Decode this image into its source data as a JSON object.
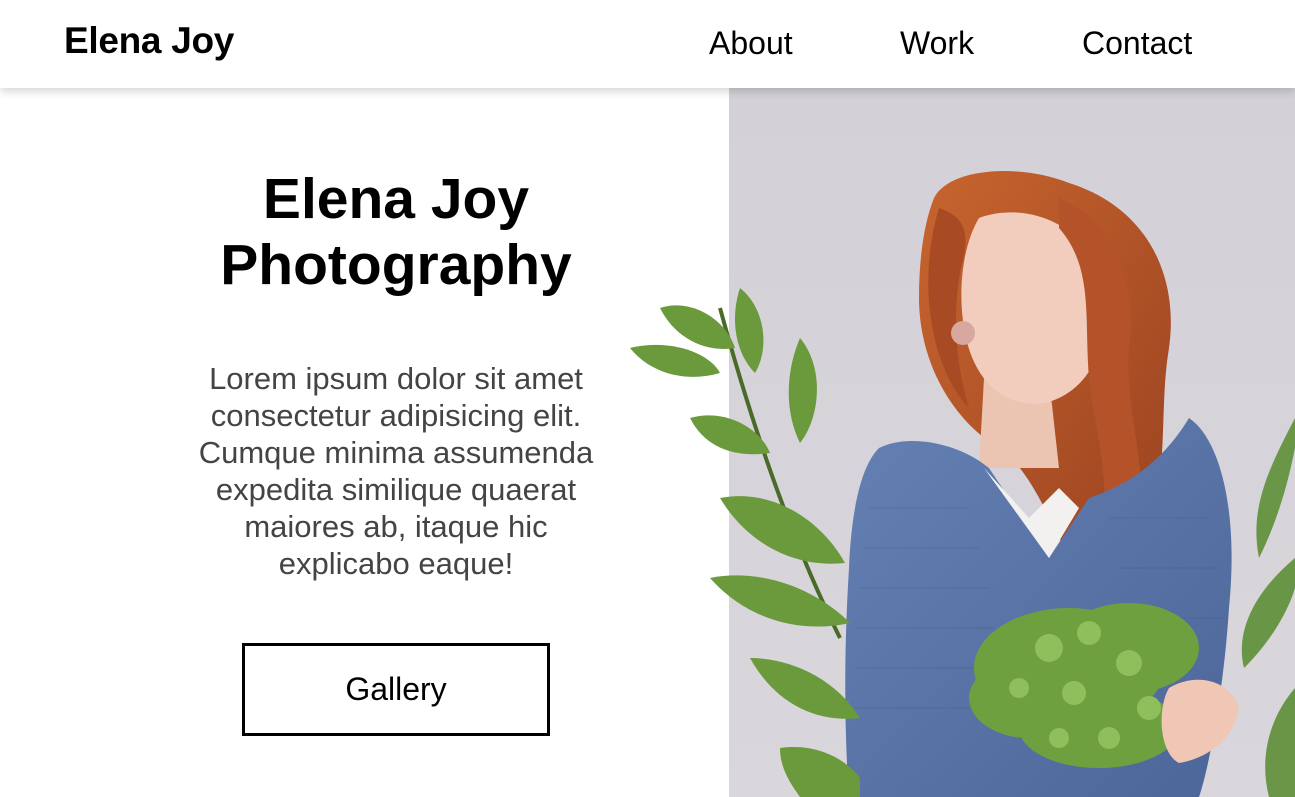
{
  "header": {
    "logo": "Elena Joy",
    "nav": [
      {
        "label": "About"
      },
      {
        "label": "Work"
      },
      {
        "label": "Contact"
      }
    ]
  },
  "hero": {
    "title_line1": "Elena Joy",
    "title_line2": "Photography",
    "description": "Lorem ipsum dolor sit amet consectetur adipisicing elit. Cumque minima assumenda expedita similique quaerat maiores ab, itaque hic explicabo eaque!",
    "gallery_button": "Gallery"
  },
  "colors": {
    "photo_background": "#d6d3d8",
    "sweater": "#5a76a8",
    "hair": "#b8562a",
    "leaf": "#6a9a3c"
  }
}
